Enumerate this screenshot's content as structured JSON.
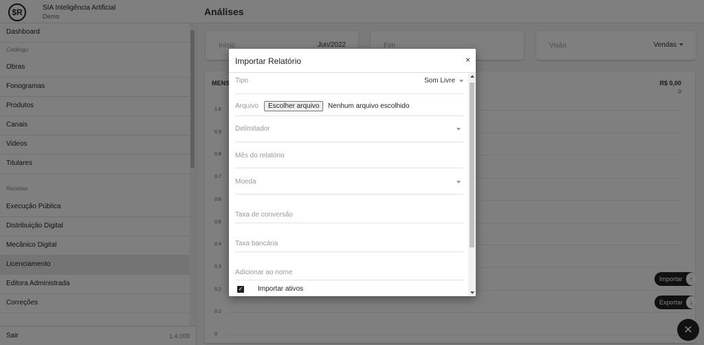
{
  "brand": {
    "logo": "$R",
    "title": "SIA Inteligência Artificial",
    "subtitle": "Demo"
  },
  "header": {
    "title": "Análises"
  },
  "sidebar": {
    "dashboard": "Dashboard",
    "section_catalogo": "Catálogo",
    "catalogo": [
      "Obras",
      "Fonogramas",
      "Produtos",
      "Canais",
      "Videos",
      "Titulares"
    ],
    "section_receitas": "Receitas",
    "receitas": [
      "Execução Pública",
      "Distribuição Digital",
      "Mecânico Digital",
      "Licenciamento",
      "Editora Administrada",
      "Correções"
    ],
    "active": "Licenciamento",
    "footer": {
      "logout": "Sair",
      "version": "1.4.009"
    }
  },
  "filters": {
    "inicio": {
      "label": "Início",
      "value": "Jun/2022"
    },
    "fim": {
      "label": "Fim",
      "value": ""
    },
    "visao": {
      "label": "Visão",
      "value": "Vendas"
    }
  },
  "chart": {
    "title_partial": "MENS",
    "total": "R$ 0,00",
    "count": "0"
  },
  "chart_data": {
    "type": "line",
    "title": "",
    "xlabel": "",
    "ylabel": "",
    "ylim": [
      0,
      1
    ],
    "yticks": [
      "1.0",
      "0.9",
      "0.8",
      "0.7",
      "0.6",
      "0.5",
      "0.4",
      "0.3",
      "0.2",
      "0.1",
      "0"
    ],
    "series": []
  },
  "actions": {
    "importar": "Importar",
    "exportar": "Exportar"
  },
  "modal": {
    "title": "Importar Relatório",
    "close": "×",
    "tipo": {
      "label": "Tipo",
      "value": "Som Livre"
    },
    "arquivo": {
      "label": "Arquivo",
      "button": "Escolher arquivo",
      "status": "Nenhum arquivo escolhido"
    },
    "delimitador": {
      "label": "Delimitador"
    },
    "mes": {
      "label": "Mês do relatório"
    },
    "moeda": {
      "label": "Moeda"
    },
    "taxa_conversao": {
      "label": "Taxa de conversão"
    },
    "taxa_bancaria": {
      "label": "Taxa bancária"
    },
    "adicionar_nome": {
      "label": "Adicionar ao nome"
    },
    "importar_ativos": {
      "label": "Importar ativos",
      "checked": true
    }
  },
  "colors": {
    "accent": "#222222",
    "overlay": "rgba(0,0,0,0.5)"
  },
  "icons": {
    "cloud": "cloud-upload-icon",
    "close": "close-icon"
  }
}
